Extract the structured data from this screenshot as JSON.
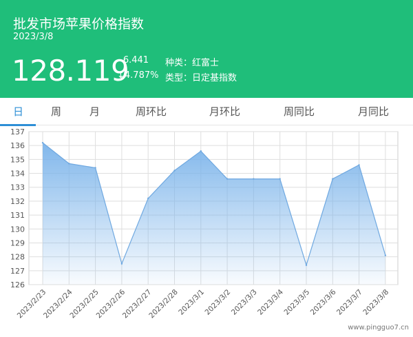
{
  "header": {
    "title": "批发市场苹果价格指数",
    "date": "2023/3/8",
    "value": "128.119",
    "change": "- 6.441",
    "change_pct": "↓4.787%",
    "kind": "种类：红富士",
    "type": "类型：日定基指数"
  },
  "tabs": [
    {
      "label": "日",
      "active": true
    },
    {
      "label": "周",
      "active": false
    },
    {
      "label": "月",
      "active": false
    },
    {
      "label": "周环比",
      "active": false
    },
    {
      "label": "月环比",
      "active": false
    },
    {
      "label": "周同比",
      "active": false
    },
    {
      "label": "月同比",
      "active": false
    }
  ],
  "watermark": "www.pingguo7.cn",
  "colors": {
    "header_bg": "#1fbe7a",
    "active_tab": "#2d8fd6",
    "area_top": "#7ab3ea",
    "line": "#6fa8e0"
  },
  "chart_data": {
    "type": "area",
    "categories": [
      "2023/2/23",
      "2023/2/24",
      "2023/2/25",
      "2023/2/26",
      "2023/2/27",
      "2023/2/28",
      "2023/3/1",
      "2023/3/2",
      "2023/3/3",
      "2023/3/4",
      "2023/3/5",
      "2023/3/6",
      "2023/3/7",
      "2023/3/8"
    ],
    "series": [
      {
        "values": [
          136.2,
          134.7,
          134.4,
          127.5,
          132.2,
          134.2,
          135.6,
          133.6,
          133.6,
          133.6,
          127.4,
          133.6,
          134.6,
          128.1
        ]
      }
    ],
    "yticks": [
      "126",
      "127",
      "128",
      "129",
      "130",
      "131",
      "132",
      "133",
      "134",
      "135",
      "136",
      "137"
    ],
    "ylim": [
      126,
      137
    ],
    "grid": true,
    "legend": "none"
  }
}
